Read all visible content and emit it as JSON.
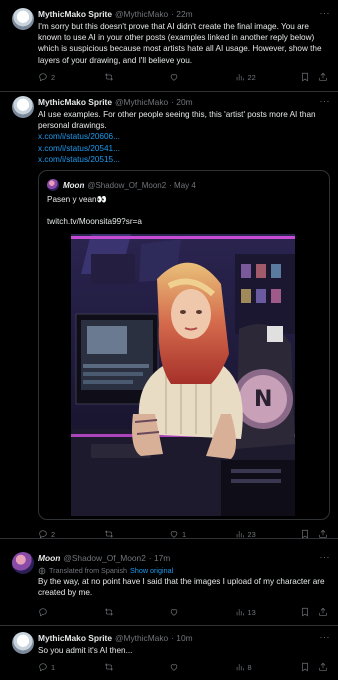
{
  "tweets": [
    {
      "name": "MythicMako Sprite",
      "handle": "@MythicMako",
      "time": "· 22m",
      "text": "I'm sorry but this doesn't prove that AI didn't create the final image. You are known to use AI in your other posts (examples linked in another reply below) which is suspicious because most artists hate all AI usage. However, show the layers of your drawing, and I'll believe you.",
      "replies": "2",
      "reposts": "",
      "likes": "",
      "views": "22"
    },
    {
      "name": "MythicMako Sprite",
      "handle": "@MythicMako",
      "time": "· 20m",
      "text": "AI use examples. For other people seeing this, this 'artist' posts more AI than personal drawings.",
      "links": [
        "x.com/i/status/20606...",
        "x.com/i/status/20541...",
        "x.com/i/status/20515..."
      ],
      "quote": {
        "name": "Moon",
        "handle": "@Shadow_Of_Moon2",
        "time": "· May 4",
        "text": "Pasen y vean👀",
        "url": "twitch.tv/Moonsita99?sr=a"
      },
      "replies": "2",
      "reposts": "",
      "likes": "1",
      "views": "23"
    },
    {
      "name": "Moon",
      "handle": "@Shadow_Of_Moon2",
      "time": "· 17m",
      "translated_label": "Translated from Spanish",
      "show_original": "Show original",
      "text": "By the way, at no point have I said that the images I upload of my character are created by me.",
      "replies": "",
      "reposts": "",
      "likes": "",
      "views": "13"
    },
    {
      "name": "MythicMako Sprite",
      "handle": "@MythicMako",
      "time": "· 10m",
      "text": "So you admit it's AI then...",
      "replies": "1",
      "reposts": "",
      "likes": "",
      "views": "8"
    }
  ],
  "more_label": "···",
  "colors": {
    "background": "#000000",
    "text": "#e7e9ea",
    "muted": "#71767b",
    "link": "#1d9bf0",
    "border": "#2f3336"
  },
  "icons": [
    "reply-icon",
    "repost-icon",
    "like-icon",
    "views-icon",
    "bookmark-icon",
    "share-icon",
    "translate-icon"
  ]
}
